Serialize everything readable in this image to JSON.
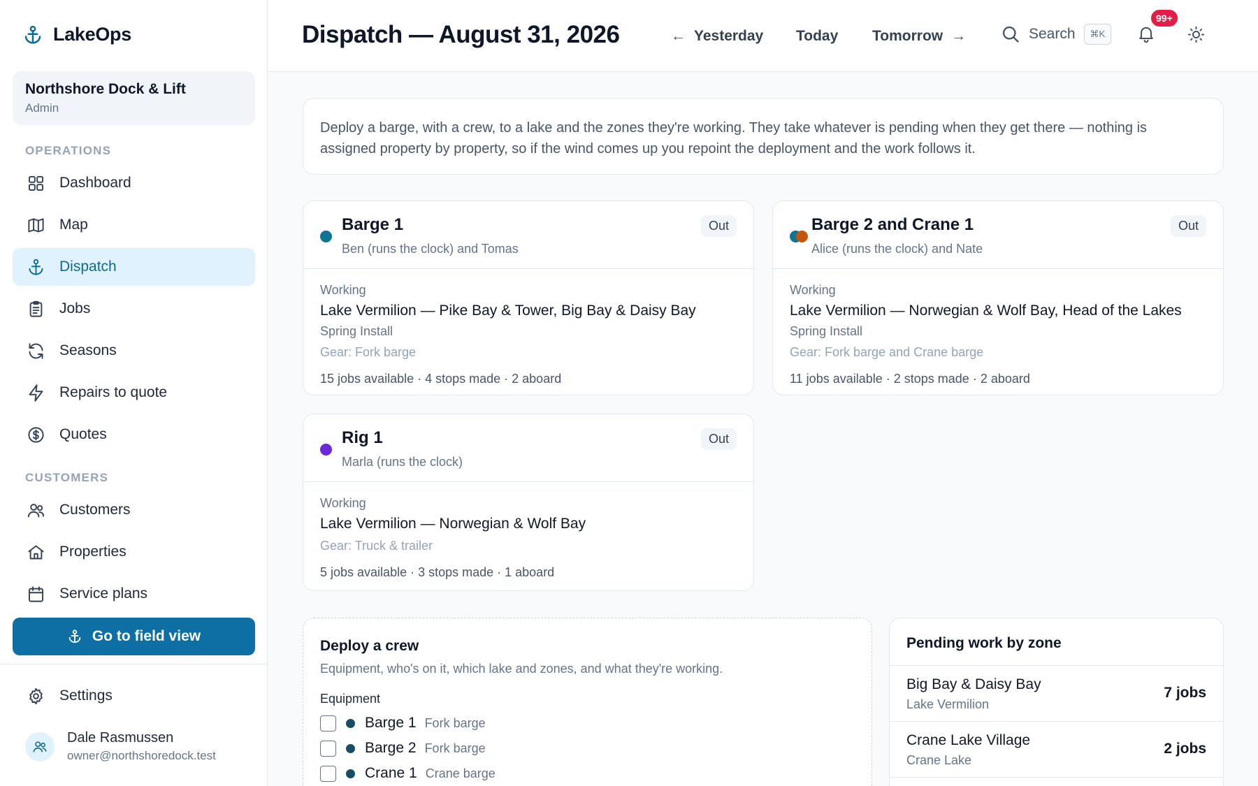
{
  "app": {
    "name": "LakeOps"
  },
  "org": {
    "name": "Northshore Dock & Lift",
    "role": "Admin"
  },
  "sidebar": {
    "sections": {
      "operations": "OPERATIONS",
      "customers": "CUSTOMERS"
    },
    "items": [
      {
        "label": "Dashboard",
        "icon": "grid-icon"
      },
      {
        "label": "Map",
        "icon": "map-icon"
      },
      {
        "label": "Dispatch",
        "icon": "anchor-icon",
        "active": true
      },
      {
        "label": "Jobs",
        "icon": "clipboard-icon"
      },
      {
        "label": "Seasons",
        "icon": "refresh-icon"
      },
      {
        "label": "Repairs to quote",
        "icon": "bolt-icon"
      },
      {
        "label": "Quotes",
        "icon": "dollar-icon"
      },
      {
        "label": "Customers",
        "icon": "users-icon"
      },
      {
        "label": "Properties",
        "icon": "home-icon"
      },
      {
        "label": "Service plans",
        "icon": "calendar-icon"
      }
    ],
    "field_view_label": "Go to field view",
    "settings_label": "Settings"
  },
  "user": {
    "name": "Dale Rasmussen",
    "email": "owner@northshoredock.test"
  },
  "header": {
    "title": "Dispatch — August 31, 2026",
    "yesterday": "Yesterday",
    "today": "Today",
    "tomorrow": "Tomorrow",
    "arrow_left": "←",
    "arrow_right": "→",
    "search_label": "Search",
    "search_shortcut": "⌘K",
    "notifications_badge": "99+"
  },
  "intro": "Deploy a barge, with a crew, to a lake and the zones they're working. They take whatever is pending when they get there — nothing is assigned property by property, so if the wind comes up you repoint the deployment and the work follows it.",
  "deployments": [
    {
      "title": "Barge 1",
      "crew": "Ben (runs the clock) and Tomas",
      "status": "Out",
      "working_label": "Working",
      "working": "Lake Vermilion — Pike Bay & Tower, Big Bay & Daisy Bay",
      "season": "Spring Install",
      "gear": "Gear: Fork barge",
      "stats": "15 jobs available · 4 stops made · 2 aboard",
      "colors": [
        "#0e7490"
      ]
    },
    {
      "title": "Barge 2 and Crane 1",
      "crew": "Alice (runs the clock) and Nate",
      "status": "Out",
      "working_label": "Working",
      "working": "Lake Vermilion — Norwegian & Wolf Bay, Head of the Lakes",
      "season": "Spring Install",
      "gear": "Gear: Fork barge and Crane barge",
      "stats": "11 jobs available · 2 stops made · 2 aboard",
      "colors": [
        "#0e7490",
        "#c2570c"
      ]
    },
    {
      "title": "Rig 1",
      "crew": "Marla (runs the clock)",
      "status": "Out",
      "working_label": "Working",
      "working": "Lake Vermilion — Norwegian & Wolf Bay",
      "gear": "Gear: Truck & trailer",
      "stats": "5 jobs available · 3 stops made · 1 aboard",
      "colors": [
        "#6d28d9"
      ]
    }
  ],
  "deploy_form": {
    "title": "Deploy a crew",
    "subtitle": "Equipment, who's on it, which lake and zones, and what they're working.",
    "equipment_label": "Equipment",
    "equipment": [
      {
        "name": "Barge 1",
        "type": "Fork barge"
      },
      {
        "name": "Barge 2",
        "type": "Fork barge"
      },
      {
        "name": "Crane 1",
        "type": "Crane barge"
      }
    ]
  },
  "pending": {
    "title": "Pending work by zone",
    "zones": [
      {
        "name": "Big Bay & Daisy Bay",
        "lake": "Lake Vermilion",
        "count": "7 jobs"
      },
      {
        "name": "Crane Lake Village",
        "lake": "Crane Lake",
        "count": "2 jobs"
      }
    ]
  }
}
